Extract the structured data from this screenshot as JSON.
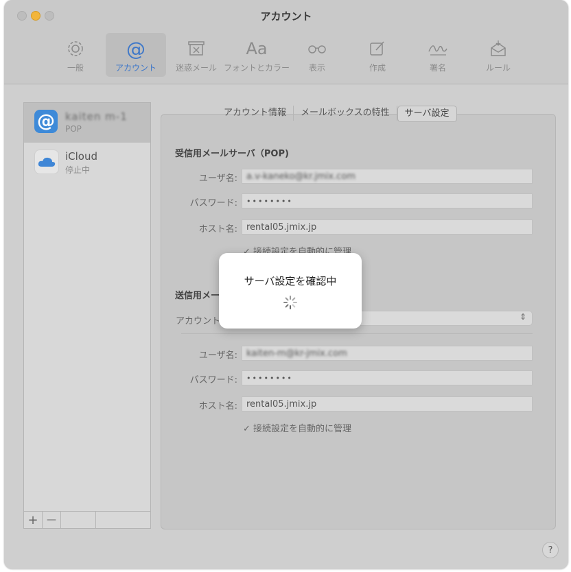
{
  "window": {
    "title": "アカウント"
  },
  "toolbar": {
    "items": [
      {
        "label": "一般",
        "icon": "gear-icon"
      },
      {
        "label": "アカウント",
        "icon": "at-icon",
        "active": true
      },
      {
        "label": "迷惑メール",
        "icon": "junk-icon"
      },
      {
        "label": "フォントとカラー",
        "icon": "fonts-icon",
        "glyph": "Aa"
      },
      {
        "label": "表示",
        "icon": "glasses-icon"
      },
      {
        "label": "作成",
        "icon": "compose-icon"
      },
      {
        "label": "署名",
        "icon": "signature-icon"
      },
      {
        "label": "ルール",
        "icon": "rules-icon"
      }
    ]
  },
  "sidebar": {
    "accounts": [
      {
        "name": "kaiten m-1",
        "sub": "POP",
        "icon": "at-icon"
      },
      {
        "name": "iCloud",
        "sub": "停止中",
        "icon": "cloud-icon"
      }
    ],
    "add_label": "+",
    "remove_label": "—"
  },
  "tabs": [
    "アカウント情報",
    "メールボックスの特性",
    "サーバ設定"
  ],
  "incoming": {
    "title": "受信用メールサーバ（POP)",
    "username_label": "ユーザ名:",
    "username_value": "a.v-kaneko@kr.jmix.com",
    "password_label": "パスワード:",
    "password_value": "••••••••",
    "host_label": "ホスト名:",
    "host_value": "rental05.jmix.jp",
    "manage_label": "接続設定を自動的に管理"
  },
  "outgoing": {
    "title": "送信用メールサーバ(SMTP)",
    "account_label": "アカウント:",
    "username_label": "ユーザ名:",
    "username_value": "kaiten-m@kr-jmix.com",
    "password_label": "パスワード:",
    "password_value": "••••••••",
    "host_label": "ホスト名:",
    "host_value": "rental05.jmix.jp",
    "manage_label": "接続設定を自動的に管理"
  },
  "overlay": {
    "text": "サーバ設定を確認中"
  },
  "help_label": "?",
  "colors": {
    "accent": "#3f78c9",
    "pop_icon": "#3e8ad8",
    "minimize": "#f2b53b"
  }
}
